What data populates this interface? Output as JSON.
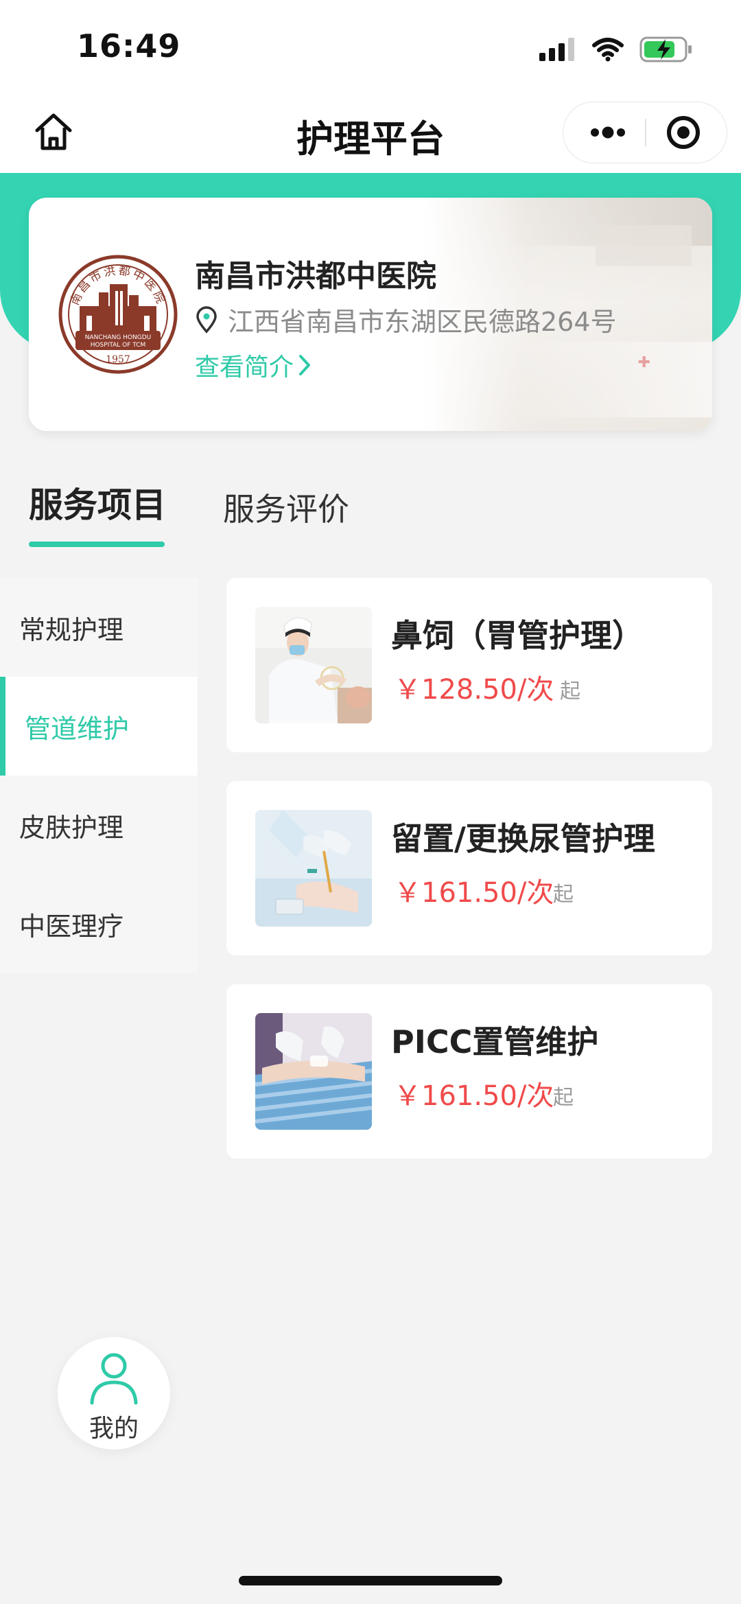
{
  "status_bar": {
    "time": "16:49"
  },
  "nav": {
    "title": "护理平台"
  },
  "hospital": {
    "name": "南昌市洪都中医院",
    "address": "江西省南昌市东湖区民德路264号",
    "intro_link": "查看简介",
    "logo": {
      "arc_text": "南昌市洪都中医院",
      "english_line1": "NANCHANG HONGDU",
      "english_line2": "HOSPITAL OF TCM",
      "year": "1957"
    }
  },
  "tabs": [
    {
      "label": "服务项目",
      "active": true
    },
    {
      "label": "服务评价",
      "active": false
    }
  ],
  "categories": [
    {
      "label": "常规护理",
      "active": false
    },
    {
      "label": "管道维护",
      "active": true
    },
    {
      "label": "皮肤护理",
      "active": false
    },
    {
      "label": "中医理疗",
      "active": false
    }
  ],
  "services": [
    {
      "name": "鼻饲（胃管护理）",
      "price": "￥128.50/次",
      "suffix": "起"
    },
    {
      "name": "留置/更换尿管护理",
      "price": "￥161.50/次",
      "suffix": "起"
    },
    {
      "name": "PICC置管维护",
      "price": "￥161.50/次",
      "suffix": "起"
    }
  ],
  "mine": {
    "label": "我的"
  },
  "colors": {
    "accent": "#2fcaa8",
    "hero": "#34d4b3",
    "price": "#f04a4a",
    "logo": "#8b3a2a"
  }
}
